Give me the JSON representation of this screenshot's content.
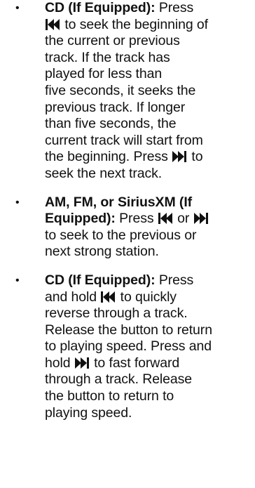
{
  "bullets": [
    {
      "marker": "•",
      "lead": "CD (If Equipped):",
      "lines": [
        {
          "before": " Press",
          "icon": null,
          "after": ""
        },
        {
          "before": "",
          "icon": "seek-back-icon",
          "after": " to seek the beginning of"
        },
        {
          "before": "the current or previous",
          "icon": null,
          "after": ""
        },
        {
          "before": "track. If the track has",
          "icon": null,
          "after": ""
        },
        {
          "before": "played for less than",
          "icon": null,
          "after": ""
        },
        {
          "before": "five seconds, it seeks the",
          "icon": null,
          "after": ""
        },
        {
          "before": "previous track. If longer",
          "icon": null,
          "after": ""
        },
        {
          "before": "than five seconds, the",
          "icon": null,
          "after": ""
        },
        {
          "before": "current track will start from",
          "icon": null,
          "after": ""
        },
        {
          "before": "the beginning. Press ",
          "icon": "seek-forward-icon",
          "after": " to"
        },
        {
          "before": "seek the next track.",
          "icon": null,
          "after": ""
        }
      ]
    },
    {
      "marker": "•",
      "lead": "AM, FM, or SiriusXM (If",
      "lines": [
        {
          "lead": "Equipped):",
          "before": " Press ",
          "icon": "seek-back-icon",
          "after": " or ",
          "icon2": "seek-forward-icon"
        },
        {
          "before": "to seek to the previous or",
          "icon": null,
          "after": ""
        },
        {
          "before": "next strong station.",
          "icon": null,
          "after": ""
        }
      ]
    },
    {
      "marker": "•",
      "lead": "CD (If Equipped):",
      "lines": [
        {
          "before": " Press",
          "icon": null,
          "after": ""
        },
        {
          "before": "and hold ",
          "icon": "seek-back-icon",
          "after": " to quickly"
        },
        {
          "before": "reverse through a track.",
          "icon": null,
          "after": ""
        },
        {
          "before": "Release the button to return",
          "icon": null,
          "after": ""
        },
        {
          "before": "to playing speed. Press and",
          "icon": null,
          "after": ""
        },
        {
          "before": "hold ",
          "icon": "seek-forward-icon",
          "after": " to fast forward"
        },
        {
          "before": "through a track. Release",
          "icon": null,
          "after": ""
        },
        {
          "before": "the button to return to",
          "icon": null,
          "after": ""
        },
        {
          "before": "playing speed.",
          "icon": null,
          "after": ""
        }
      ]
    }
  ]
}
